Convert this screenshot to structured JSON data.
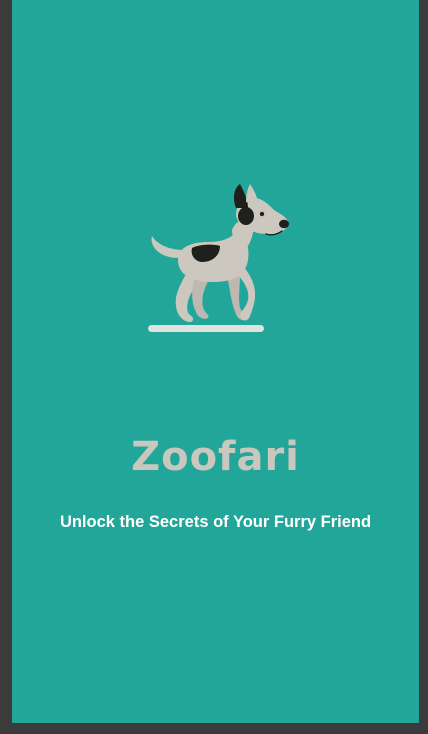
{
  "app": {
    "title": "Zoofari",
    "tagline": "Unlock the Secrets of Your Furry Friend"
  },
  "mascot": {
    "icon": "dog-icon"
  },
  "colors": {
    "background": "#22a69a",
    "frame": "#3b3b3b",
    "title": "#c9c7be",
    "tagline": "#ffffff",
    "dog_body": "#ccc8bf",
    "dog_spots": "#1f1f1b"
  }
}
